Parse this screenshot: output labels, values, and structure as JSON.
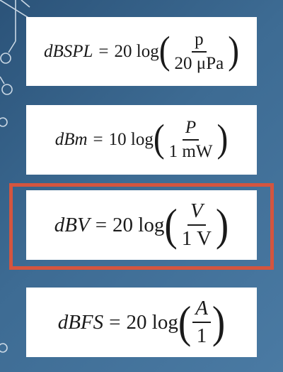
{
  "equations": [
    {
      "lhs": "dBSPL",
      "op": "=",
      "func": "20 log",
      "numerator": "p",
      "denominator": "20 μPa"
    },
    {
      "lhs": "dBm",
      "op": "=",
      "func": "10 log",
      "numerator": "P",
      "denominator": "1 mW"
    },
    {
      "lhs": "dBV",
      "op": "=",
      "func": "20 log",
      "numerator": "V",
      "denominator": "1 V"
    },
    {
      "lhs": "dBFS",
      "op": "=",
      "func": "20 log",
      "numerator": "A",
      "denominator": "1"
    }
  ],
  "colors": {
    "background": "#3d6b93",
    "card": "#ffffff",
    "highlight": "#d4553f",
    "circuit": "#dbe6f0"
  }
}
